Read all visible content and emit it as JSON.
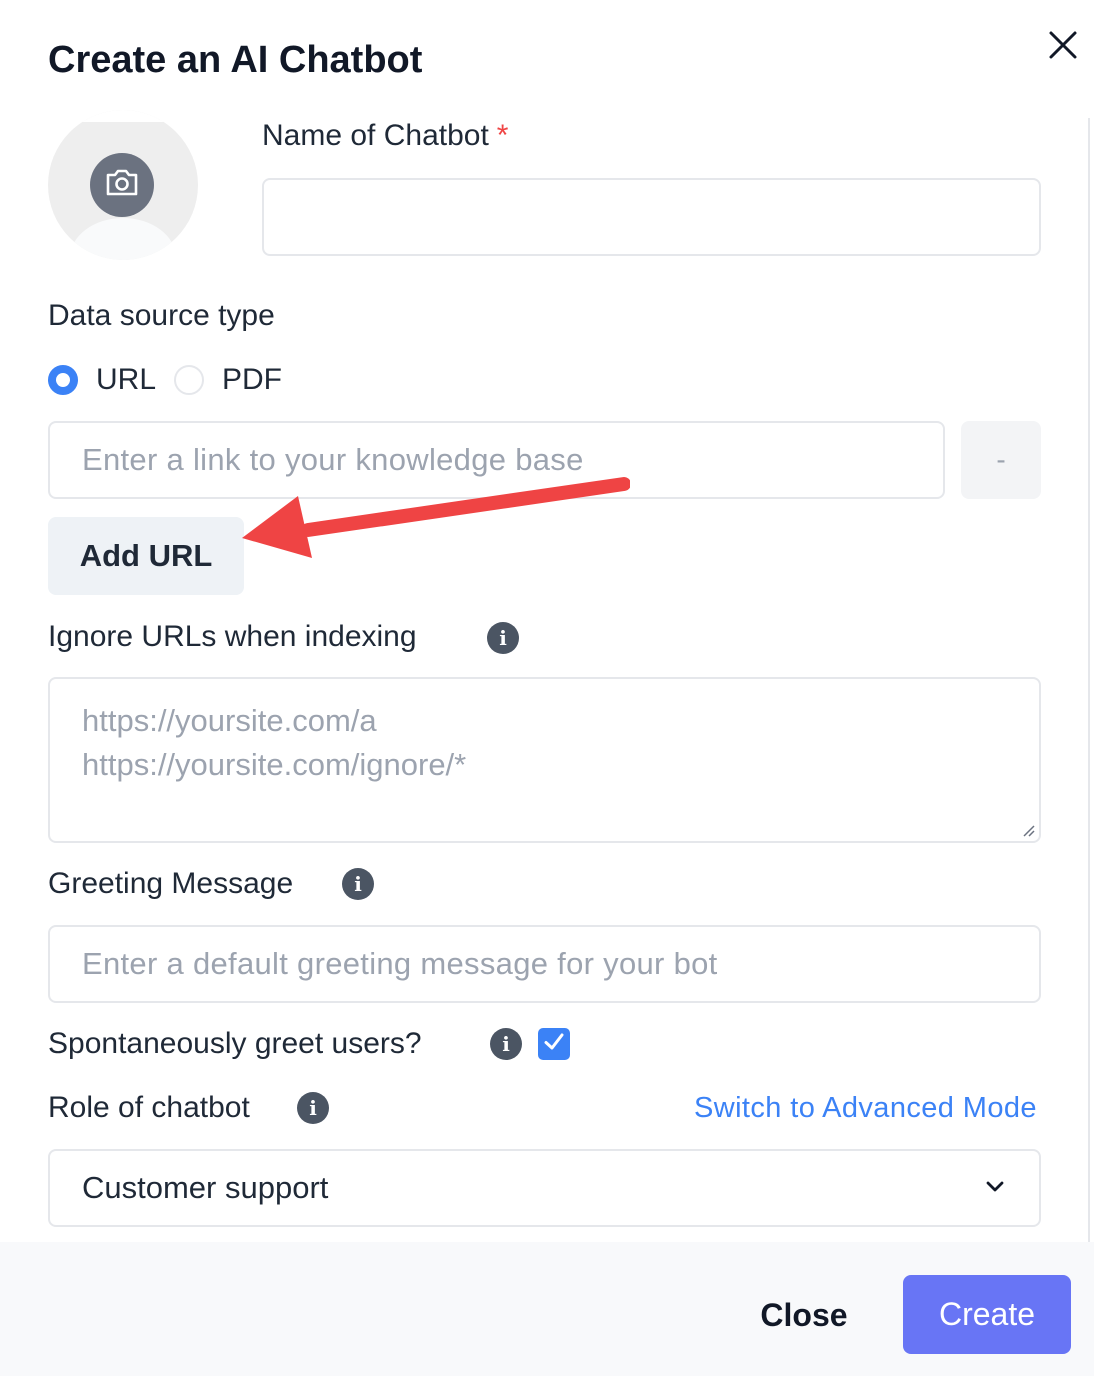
{
  "dialog": {
    "title": "Create an AI Chatbot"
  },
  "form": {
    "name_label": "Name of Chatbot",
    "required_mark": "*",
    "name_value": "",
    "data_source_label": "Data source type",
    "source_options": [
      {
        "label": "URL",
        "selected": true
      },
      {
        "label": "PDF",
        "selected": false
      }
    ],
    "url_placeholder": "Enter a link to your knowledge base",
    "remove_label": "-",
    "add_url_label": "Add URL",
    "ignore_label": "Ignore URLs when indexing",
    "ignore_placeholder_lines": [
      "https://yoursite.com/a",
      "https://yoursite.com/ignore/*"
    ],
    "greeting_label": "Greeting Message",
    "greeting_placeholder": "Enter a default greeting message for your bot",
    "spontaneous_label": "Spontaneously greet users?",
    "spontaneous_checked": true,
    "role_label": "Role of chatbot",
    "advanced_link": "Switch to Advanced Mode",
    "role_value": "Customer support"
  },
  "footer": {
    "close_label": "Close",
    "create_label": "Create"
  },
  "colors": {
    "accent": "#3b82f6",
    "primary_button": "#6875f5",
    "annotation_arrow": "#ef4444",
    "required": "#ef4444"
  },
  "icons": [
    "close-icon",
    "camera-icon",
    "info-icon",
    "check-icon",
    "chevron-down-icon",
    "arrow-annotation"
  ]
}
